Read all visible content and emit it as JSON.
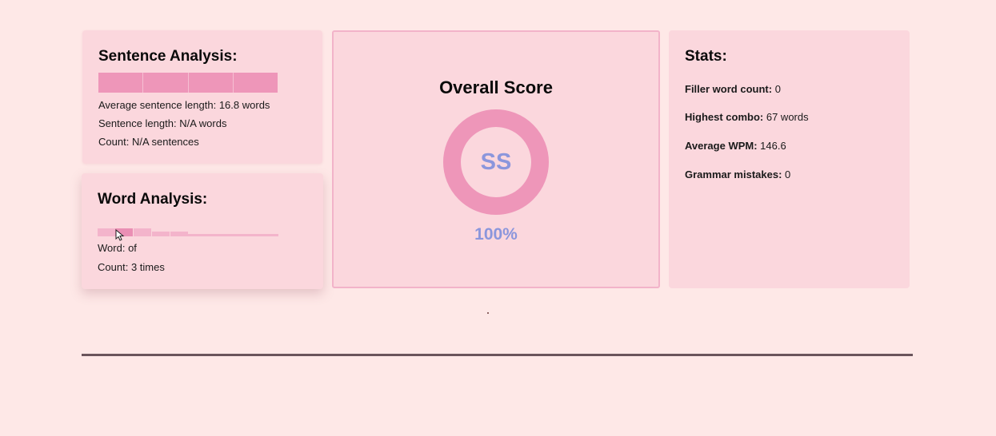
{
  "sentence_analysis": {
    "title": "Sentence Analysis:",
    "bar_segments": 4,
    "average_label": "Average sentence length:",
    "average_value": "16.8 words",
    "length_label": "Sentence length:",
    "length_value": "N/A words",
    "count_label": "Count:",
    "count_value": "N/A sentences"
  },
  "word_analysis": {
    "title": "Word Analysis:",
    "word_label": "Word:",
    "word_value": "of",
    "count_label": "Count:",
    "count_value": "3 times"
  },
  "overall_score": {
    "title": "Overall Score",
    "grade": "SS",
    "percent": "100%",
    "score_fraction": 1.0
  },
  "stats": {
    "title": "Stats:",
    "items": [
      {
        "label": "Filler word count:",
        "value": "0"
      },
      {
        "label": "Highest combo:",
        "value": "67 words"
      },
      {
        "label": "Average WPM:",
        "value": "146.6"
      },
      {
        "label": "Grammar mistakes:",
        "value": "0"
      }
    ]
  },
  "colors": {
    "background": "#fee8e7",
    "card": "#fbd7dd",
    "bar_pink": "#ee96b9",
    "ring_pink": "#ee96b9",
    "score_text": "#8b96dc",
    "divider": "#6a545b"
  }
}
